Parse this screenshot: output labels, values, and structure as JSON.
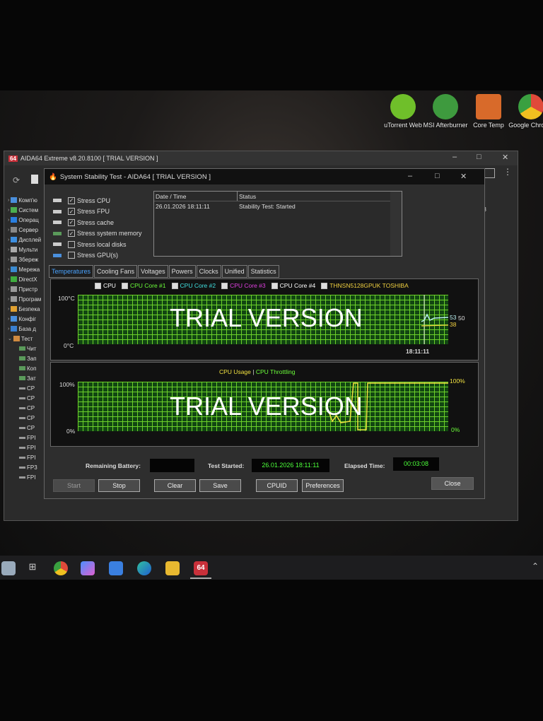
{
  "desktop": {
    "icons": [
      {
        "label": "uTorrent Web",
        "color": "#6fbf2a"
      },
      {
        "label": "MSI Afterburner",
        "color": "#3e9a3e"
      },
      {
        "label": "Core Temp",
        "color": "#d86a2a"
      },
      {
        "label": "Google Chrome",
        "color": "#e04a3a"
      }
    ]
  },
  "main_window": {
    "title": "AIDA64 Extreme v8.20.8100  [ TRIAL VERSION ]",
    "badge": "64",
    "side_text": "A3",
    "tree": [
      {
        "label": "Комп'ю",
        "color": "#4a8fdc"
      },
      {
        "label": "Систем",
        "color": "#4caf50"
      },
      {
        "label": "Операц",
        "color": "#2a7fe0"
      },
      {
        "label": "Сервер",
        "color": "#888"
      },
      {
        "label": "Дисплей",
        "color": "#3d8fe0"
      },
      {
        "label": "Мульти",
        "color": "#aaa"
      },
      {
        "label": "Збереж",
        "color": "#999"
      },
      {
        "label": "Мережа",
        "color": "#3a8ad0"
      },
      {
        "label": "DirectX",
        "color": "#3fae3f"
      },
      {
        "label": "Пристр",
        "color": "#999"
      },
      {
        "label": "Програм",
        "color": "#999"
      },
      {
        "label": "Безпека",
        "color": "#e0a030"
      },
      {
        "label": "Конфіг",
        "color": "#4a8fdc"
      },
      {
        "label": "База д",
        "color": "#3a7fd0"
      },
      {
        "label": "Тест",
        "color": "#d08a40",
        "expanded": true
      }
    ],
    "tree_children": [
      "Чит",
      "Зап",
      "Коп",
      "Зат",
      "CP",
      "CP",
      "CP",
      "CP",
      "CP",
      "FPI",
      "FPI",
      "FPI",
      "FP3",
      "FPI"
    ]
  },
  "dialog": {
    "title": "System Stability Test - AIDA64  [ TRIAL VERSION ]",
    "stress_options": [
      {
        "label": "Stress CPU",
        "checked": true
      },
      {
        "label": "Stress FPU",
        "checked": true
      },
      {
        "label": "Stress cache",
        "checked": true
      },
      {
        "label": "Stress system memory",
        "checked": true
      },
      {
        "label": "Stress local disks",
        "checked": false
      },
      {
        "label": "Stress GPU(s)",
        "checked": false
      }
    ],
    "log": {
      "headers": [
        "Date / Time",
        "Status"
      ],
      "rows": [
        [
          "26.01.2026 18:11:11",
          "Stability Test: Started"
        ]
      ]
    },
    "tabs": [
      "Temperatures",
      "Cooling Fans",
      "Voltages",
      "Powers",
      "Clocks",
      "Unified",
      "Statistics"
    ],
    "active_tab": "Temperatures",
    "temp_graph": {
      "legend": [
        {
          "label": "CPU",
          "color": "#ffffff"
        },
        {
          "label": "CPU Core #1",
          "color": "#6cff3a"
        },
        {
          "label": "CPU Core #2",
          "color": "#40e0e0"
        },
        {
          "label": "CPU Core #3",
          "color": "#e040e0"
        },
        {
          "label": "CPU Core #4",
          "color": "#ffffff"
        },
        {
          "label": "THNSN5128GPUK TOSHIBA",
          "color": "#f0d040"
        }
      ],
      "y_max": "100°C",
      "y_min": "0°C",
      "time": "18:11:11",
      "values": [
        "53",
        "50",
        "38"
      ],
      "watermark": "TRIAL VERSION"
    },
    "usage_graph": {
      "legend_usage": "CPU Usage",
      "separator": "|",
      "legend_throttle": "CPU Throttling",
      "y_max": "100%",
      "y_min": "0%",
      "right_max": "100%",
      "right_min": "0%",
      "watermark": "TRIAL VERSION"
    },
    "remaining_battery_label": "Remaining Battery:",
    "remaining_battery": "",
    "test_started_label": "Test Started:",
    "test_started": "26.01.2026 18:11:11",
    "elapsed_label": "Elapsed Time:",
    "elapsed": "00:03:08",
    "buttons": {
      "start": "Start",
      "stop": "Stop",
      "clear": "Clear",
      "save": "Save",
      "cpuid": "CPUID",
      "preferences": "Preferences",
      "close": "Close"
    }
  },
  "taskbar": {
    "active": "64"
  }
}
